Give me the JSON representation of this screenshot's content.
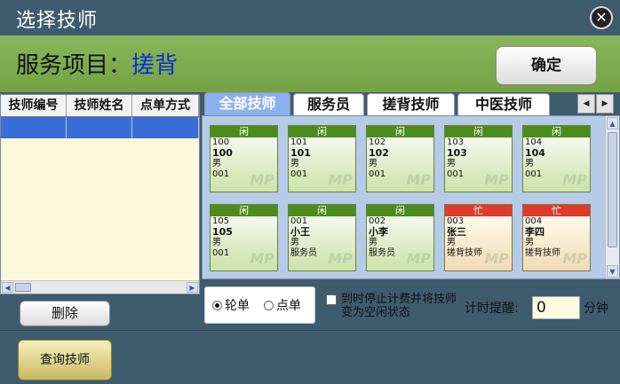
{
  "window": {
    "title": "选择技师"
  },
  "header": {
    "service_label": "服务项目：",
    "service_value": "搓背",
    "confirm_label": "确定"
  },
  "grid": {
    "columns": [
      "技师编号",
      "技师姓名",
      "点单方式"
    ]
  },
  "left": {
    "delete_label": "删除"
  },
  "tabs": [
    "全部技师",
    "服务员",
    "搓背技师",
    "中医技师"
  ],
  "cards": [
    {
      "status": "闲",
      "id": "100",
      "name": "100",
      "gender": "男",
      "role": "001",
      "busy": false
    },
    {
      "status": "闲",
      "id": "101",
      "name": "101",
      "gender": "男",
      "role": "001",
      "busy": false
    },
    {
      "status": "闲",
      "id": "102",
      "name": "102",
      "gender": "男",
      "role": "001",
      "busy": false
    },
    {
      "status": "闲",
      "id": "103",
      "name": "103",
      "gender": "男",
      "role": "001",
      "busy": false
    },
    {
      "status": "闲",
      "id": "104",
      "name": "104",
      "gender": "男",
      "role": "001",
      "busy": false
    },
    {
      "status": "闲",
      "id": "105",
      "name": "105",
      "gender": "男",
      "role": "001",
      "busy": false
    },
    {
      "status": "闲",
      "id": "001",
      "name": "小王",
      "gender": "男",
      "role": "服务员",
      "busy": false
    },
    {
      "status": "闲",
      "id": "002",
      "name": "小李",
      "gender": "男",
      "role": "服务员",
      "busy": false
    },
    {
      "status": "忙",
      "id": "003",
      "name": "张三",
      "gender": "男",
      "role": "搓背技师",
      "busy": true
    },
    {
      "status": "忙",
      "id": "004",
      "name": "李四",
      "gender": "男",
      "role": "搓背技师",
      "busy": true
    }
  ],
  "card_watermark": "MP",
  "order_mode": {
    "option_1": "轮单",
    "option_2": "点单",
    "selected": "轮单"
  },
  "stop_option": {
    "label": "到时停止计费并将技师变为空闲状态",
    "checked": false
  },
  "timer": {
    "label": "计时提醒:",
    "value": "0",
    "unit": "分钟"
  },
  "footer": {
    "query_label": "查询技师"
  },
  "colors": {
    "idle": "#4d8c1c",
    "busy": "#e03a2c",
    "accent": "#8cb0ee",
    "service": "#0a2fd0"
  }
}
